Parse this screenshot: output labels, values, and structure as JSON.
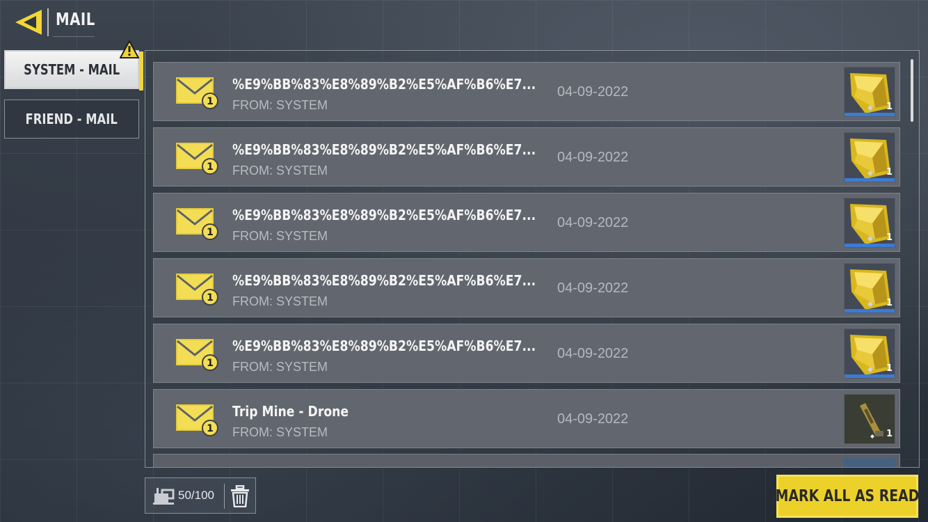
{
  "header": {
    "title": "MAIL",
    "back_icon": "back-arrow-icon"
  },
  "tabs": [
    {
      "label": "SYSTEM - MAIL",
      "selected": true,
      "alert_icon": "warning-icon"
    },
    {
      "label": "FRIEND - MAIL",
      "selected": false
    }
  ],
  "mails": [
    {
      "subject": "%E9%BB%83%E8%89%B2%E5%AF%B6%E7...",
      "from": "FROM: SYSTEM",
      "date": "04-09-2022",
      "badge": "1",
      "reward_qty": "1",
      "reward_icon": "gold-crate-icon"
    },
    {
      "subject": "%E9%BB%83%E8%89%B2%E5%AF%B6%E7...",
      "from": "FROM: SYSTEM",
      "date": "04-09-2022",
      "badge": "1",
      "reward_qty": "1",
      "reward_icon": "gold-crate-icon"
    },
    {
      "subject": "%E9%BB%83%E8%89%B2%E5%AF%B6%E7...",
      "from": "FROM: SYSTEM",
      "date": "04-09-2022",
      "badge": "1",
      "reward_qty": "1",
      "reward_icon": "gold-crate-icon"
    },
    {
      "subject": "%E9%BB%83%E8%89%B2%E5%AF%B6%E7...",
      "from": "FROM: SYSTEM",
      "date": "04-09-2022",
      "badge": "1",
      "reward_qty": "1",
      "reward_icon": "gold-crate-icon"
    },
    {
      "subject": "%E9%BB%83%E8%89%B2%E5%AF%B6%E7...",
      "from": "FROM: SYSTEM",
      "date": "04-09-2022",
      "badge": "1",
      "reward_qty": "1",
      "reward_icon": "gold-crate-icon"
    },
    {
      "subject": "Trip Mine - Drone",
      "from": "FROM: SYSTEM",
      "date": "04-09-2022",
      "badge": "1",
      "reward_qty": "1",
      "reward_icon": "trip-mine-drone-icon"
    }
  ],
  "footer": {
    "capacity": "50/100",
    "mark_all_label": "MARK ALL AS READ"
  },
  "colors": {
    "accent_yellow": "#ecd12a",
    "row_bg": "#62666e",
    "rarity_blue": "#3a7bd4"
  }
}
